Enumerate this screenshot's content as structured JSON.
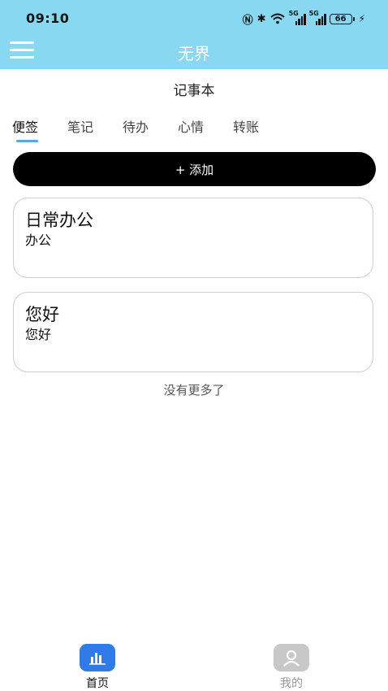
{
  "status_bar": {
    "time": "09:10",
    "battery": "66"
  },
  "header": {
    "title": "无界"
  },
  "page": {
    "title": "记事本"
  },
  "tabs": [
    {
      "label": "便签"
    },
    {
      "label": "笔记"
    },
    {
      "label": "待办"
    },
    {
      "label": "心情"
    },
    {
      "label": "转账"
    }
  ],
  "add_button": {
    "label": "+ 添加"
  },
  "notes": [
    {
      "title": "日常办公",
      "content": "办公"
    },
    {
      "title": "您好",
      "content": "您好"
    }
  ],
  "list_end_text": "没有更多了",
  "bottom_nav": [
    {
      "label": "首页",
      "icon": "chart-icon",
      "active": true,
      "color": "#2f7be8"
    },
    {
      "label": "我的",
      "icon": "user-icon",
      "active": false,
      "color": "#c8c8c8"
    }
  ]
}
